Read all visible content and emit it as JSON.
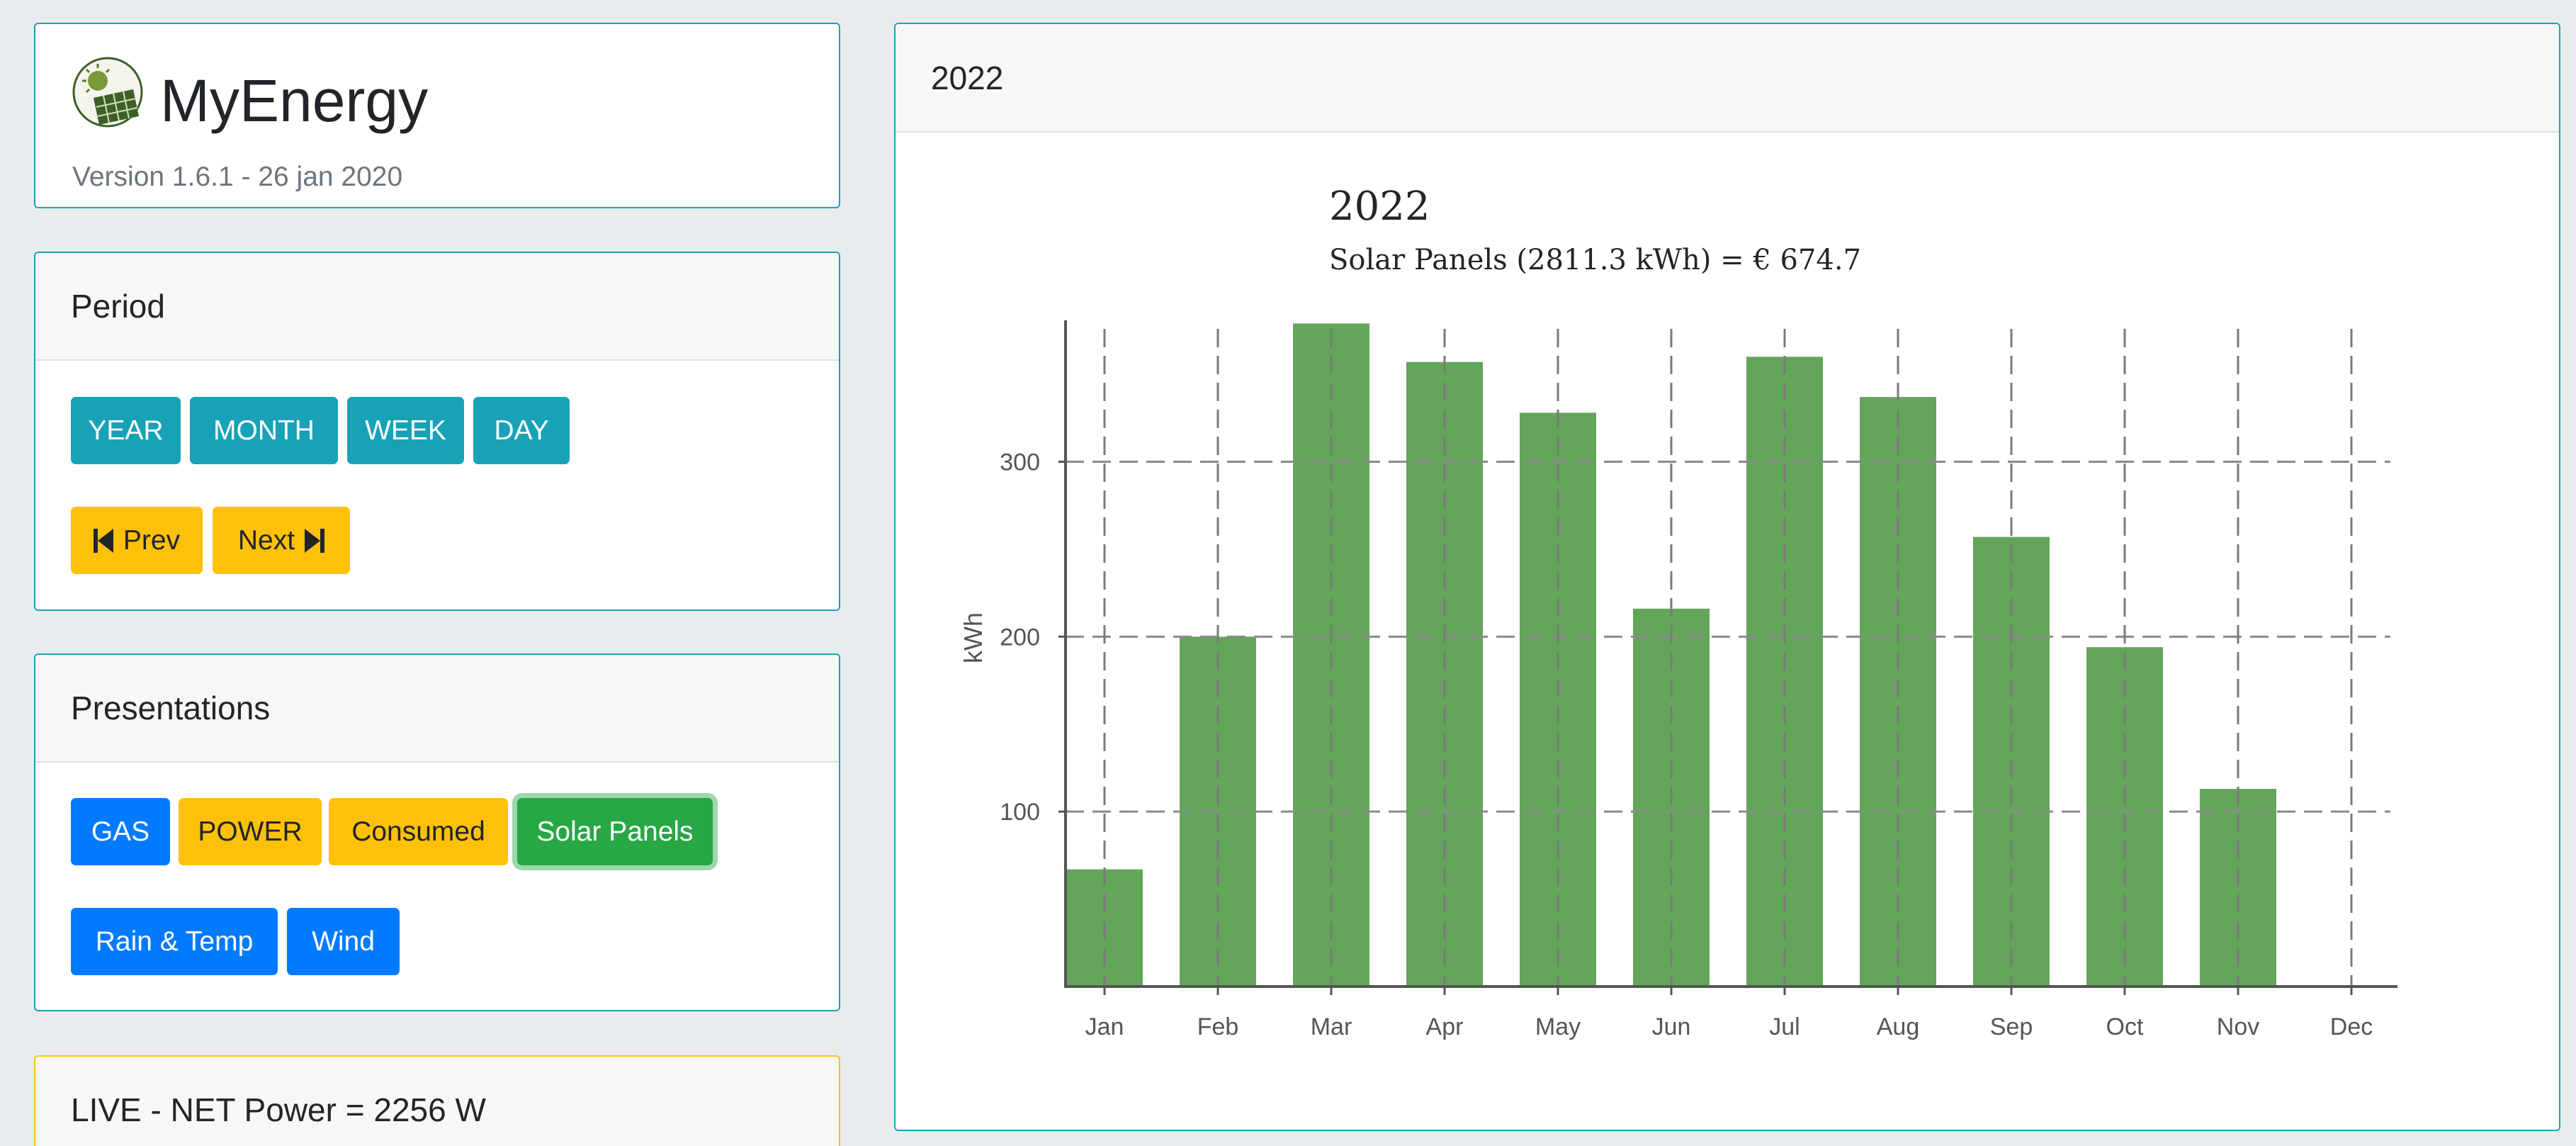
{
  "brand": {
    "title": "MyEnergy",
    "version": "Version 1.6.1 - 26 jan 2020",
    "logo_icon": "solar-panel-sun-icon"
  },
  "period": {
    "header": "Period",
    "buttons": {
      "year": "YEAR",
      "month": "MONTH",
      "week": "WEEK",
      "day": "DAY",
      "prev": "Prev",
      "next": "Next"
    }
  },
  "presentations": {
    "header": "Presentations",
    "buttons": {
      "gas": "GAS",
      "power": "POWER",
      "consumed": "Consumed",
      "solar": "Solar Panels",
      "rain": "Rain & Temp",
      "wind": "Wind"
    },
    "active": "Solar Panels"
  },
  "live": {
    "header": "LIVE - NET Power = 2256 W"
  },
  "chart_card": {
    "header": "2022"
  },
  "colors": {
    "info": "#17a2b8",
    "warning": "#ffc107",
    "primary": "#007bff",
    "success": "#28a745",
    "bar": "#63a65a"
  },
  "chart_data": {
    "type": "bar",
    "title": "2022",
    "subtitle": "Solar Panels (2811.3 kWh) = € 674.7",
    "ylabel": "kWh",
    "xlabel": "",
    "categories": [
      "Jan",
      "Feb",
      "Mar",
      "Apr",
      "May",
      "Jun",
      "Jul",
      "Aug",
      "Sep",
      "Oct",
      "Nov",
      "Dec"
    ],
    "values": [
      67,
      200,
      379,
      357,
      328,
      216,
      360,
      337,
      257,
      194,
      113,
      0
    ],
    "ylim": [
      0,
      380
    ],
    "yticks": [
      100,
      200,
      300
    ],
    "grid": true,
    "grid_style": "dashed"
  }
}
